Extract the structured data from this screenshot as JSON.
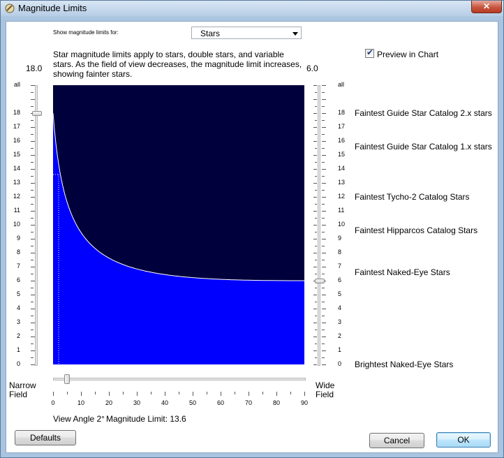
{
  "window": {
    "title": "Magnitude Limits"
  },
  "controls": {
    "show_for_label": "Show magnitude limits for:",
    "object_type": "Stars",
    "description": "Star magnitude limits apply to stars, double stars, and variable stars.  As the field of view decreases, the magnitude limit increases, showing fainter stars.",
    "preview_label": "Preview in Chart",
    "preview_checked": true
  },
  "left_slider": {
    "value_label": "18.0",
    "value": 18.0
  },
  "right_slider": {
    "value_label": "6.0",
    "value": 6.0
  },
  "magnitude_ticks": [
    "all",
    "18",
    "17",
    "16",
    "15",
    "14",
    "13",
    "12",
    "11",
    "10",
    "9",
    "8",
    "7",
    "6",
    "5",
    "4",
    "3",
    "2",
    "1",
    "0"
  ],
  "catalogs": [
    {
      "label": "Faintest Guide Star Catalog 2.x stars",
      "magnitude": 18
    },
    {
      "label": "Faintest Guide Star Catalog 1.x stars",
      "magnitude": 15.6
    },
    {
      "label": "Faintest Tycho-2 Catalog Stars",
      "magnitude": 12
    },
    {
      "label": "Faintest Hipparcos Catalog Stars",
      "magnitude": 9.6
    },
    {
      "label": "Faintest Naked-Eye Stars",
      "magnitude": 6.6
    },
    {
      "label": "Brightest Naked-Eye Stars",
      "magnitude": 0
    }
  ],
  "field_labels": {
    "narrow_1": "Narrow",
    "narrow_2": "Field",
    "wide_1": "Wide",
    "wide_2": "Field"
  },
  "x_axis": {
    "ticks": [
      "0",
      "10",
      "20",
      "30",
      "40",
      "50",
      "60",
      "70",
      "80",
      "90"
    ]
  },
  "status": {
    "view_angle": "View Angle 2°",
    "magnitude_limit": "Magnitude Limit: 13.6"
  },
  "buttons": {
    "defaults": "Defaults",
    "cancel": "Cancel",
    "ok": "OK"
  },
  "colors": {
    "sky": "#00003c",
    "limit_fill": "#0000ff",
    "curve": "#ffffff",
    "marker": "#ffffff"
  },
  "chart_data": {
    "type": "area",
    "x_range": [
      0,
      90
    ],
    "y_range": [
      0,
      20
    ],
    "narrow_mag": 18.0,
    "wide_mag": 6.0,
    "marker": {
      "view_angle": 2,
      "magnitude_limit": 13.6
    }
  }
}
